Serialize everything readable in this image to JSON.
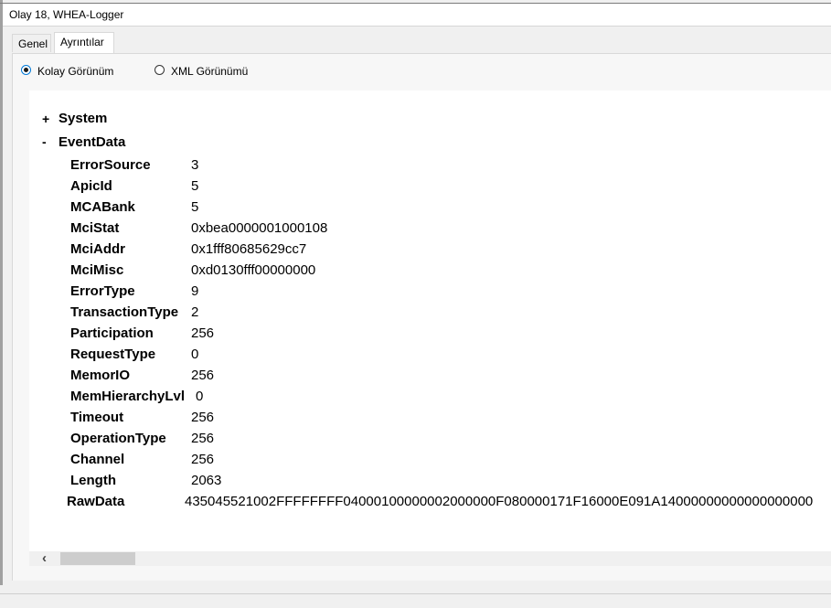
{
  "window": {
    "title": "Olay 18, WHEA-Logger"
  },
  "tabs": [
    {
      "label": "Genel",
      "active": false
    },
    {
      "label": "Ayrıntılar",
      "active": true
    }
  ],
  "view_options": {
    "friendly": {
      "label": "Kolay Görünüm",
      "checked": true
    },
    "xml": {
      "label": "XML Görünümü",
      "checked": false
    }
  },
  "tree": {
    "system": {
      "toggle": "+",
      "label": "System"
    },
    "event_data": {
      "toggle": "-",
      "label": "EventData",
      "fields": [
        {
          "name": "ErrorSource",
          "value": "3"
        },
        {
          "name": "ApicId",
          "value": "5"
        },
        {
          "name": "MCABank",
          "value": "5"
        },
        {
          "name": "MciStat",
          "value": "0xbea0000001000108"
        },
        {
          "name": "MciAddr",
          "value": "0x1fff80685629cc7"
        },
        {
          "name": "MciMisc",
          "value": "0xd0130fff00000000"
        },
        {
          "name": "ErrorType",
          "value": "9"
        },
        {
          "name": "TransactionType",
          "value": "2"
        },
        {
          "name": "Participation",
          "value": "256"
        },
        {
          "name": "RequestType",
          "value": "0"
        },
        {
          "name": "MemorIO",
          "value": "256"
        },
        {
          "name": "MemHierarchyLvl",
          "value": "0"
        },
        {
          "name": "Timeout",
          "value": "256"
        },
        {
          "name": "OperationType",
          "value": "256"
        },
        {
          "name": "Channel",
          "value": "256"
        },
        {
          "name": "Length",
          "value": "2063"
        }
      ],
      "raw": {
        "name": "RawData",
        "value": "435045521002FFFFFFFF04000100000002000000F080000171F16000E091A14000000000000000000"
      }
    }
  },
  "scrollbar": {
    "left_arrow": "‹"
  }
}
